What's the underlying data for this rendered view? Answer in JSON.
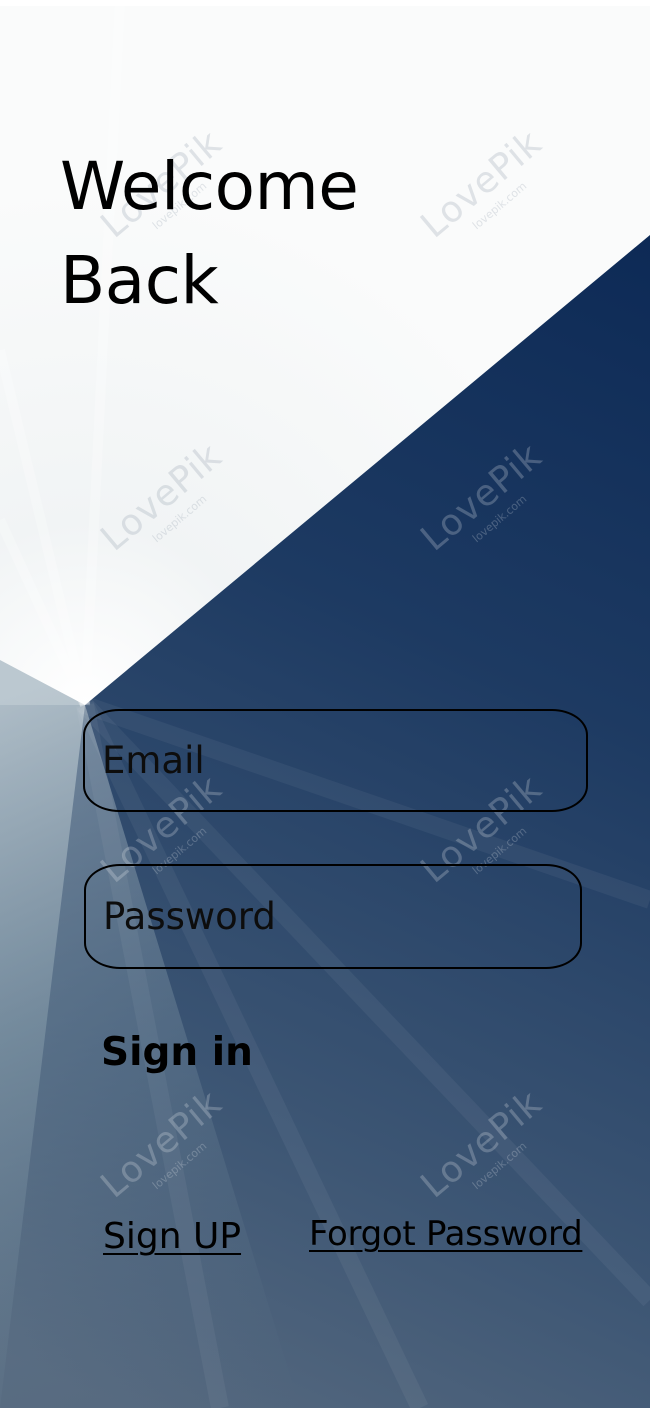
{
  "header": {
    "title_line1": "Welcome",
    "title_line2": "Back"
  },
  "form": {
    "email": {
      "placeholder": "Email",
      "value": ""
    },
    "password": {
      "placeholder": "Password",
      "value": ""
    },
    "signin_label": "Sign in"
  },
  "links": {
    "signup_label": "Sign UP",
    "forgot_label": "Forgot Password"
  },
  "watermark": {
    "main": "LovePik",
    "sub": "lovepik.com"
  },
  "colors": {
    "navy": "#0f2a55",
    "slate": "#5f7a8e",
    "light": "#f6f8f8"
  }
}
